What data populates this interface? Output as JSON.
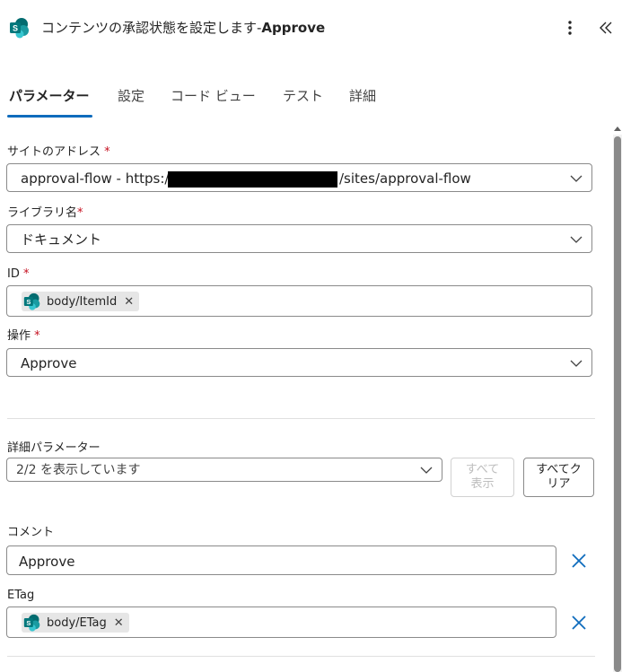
{
  "header": {
    "title_main": "コンテンツの承認状態を設定します-",
    "title_bold": "Approve",
    "icon": "sharepoint-icon"
  },
  "tabs": [
    {
      "label": "パラメーター",
      "active": true
    },
    {
      "label": "設定"
    },
    {
      "label": "コード ビュー"
    },
    {
      "label": "テスト"
    },
    {
      "label": "詳細"
    }
  ],
  "fields": {
    "site_address": {
      "label": "サイトのアドレス",
      "required": "*",
      "value_prefix": "approval-flow - https://s",
      "value_suffix": "/sites/approval-flow"
    },
    "library_name": {
      "label": "ライブラリ名",
      "required": "*",
      "value": "ドキュメント"
    },
    "id": {
      "label": "ID",
      "required": "*",
      "token": "body/ItemId"
    },
    "action": {
      "label": "操作",
      "required": "*",
      "value": "Approve"
    }
  },
  "advanced": {
    "label": "詳細パラメーター",
    "select_value": "2/2 を表示しています",
    "show_all_line1": "すべて",
    "show_all_line2": "表示",
    "clear_all_line1": "すべてク",
    "clear_all_line2": "リア"
  },
  "comment": {
    "label": "コメント",
    "value": "Approve"
  },
  "etag": {
    "label": "ETag",
    "token": "body/ETag"
  },
  "colors": {
    "accent": "#0f6cbd",
    "required": "#c50f1f",
    "sharepoint": "#036c70"
  }
}
